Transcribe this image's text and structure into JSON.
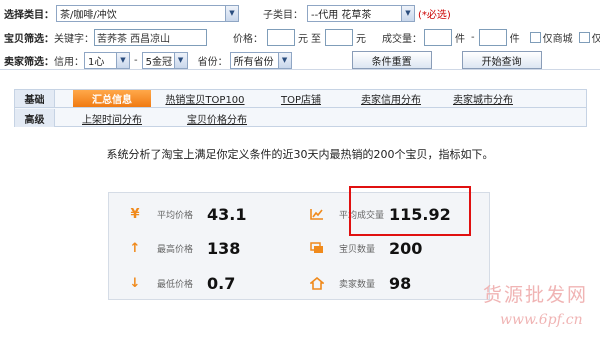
{
  "filters": {
    "category_label": "选择类目：",
    "category_value": "茶/咖啡/冲饮",
    "subcategory_label": "子类目：",
    "subcategory_value": "--代用 花草茶",
    "required_note": "(*必选)",
    "item_filter_label": "宝贝筛选：",
    "keyword_label": "关键字：",
    "keyword_value": "苦荞茶 西昌凉山",
    "price_label": "价格：",
    "price_unit_1": "元",
    "price_to": "至",
    "price_unit_2": "元",
    "sales_label": "成交量：",
    "sales_unit_1": "件",
    "sales_dash": "-",
    "sales_unit_2": "件",
    "mall_only_label": "仅商城",
    "free_ship_label": "仅包邮",
    "seller_filter_label": "卖家筛选：",
    "credit_label": "信用：",
    "credit_min": "1心",
    "credit_dash": "-",
    "credit_max": "5金冠",
    "province_label": "省份：",
    "province_value": "所有省份",
    "reset_button": "条件重置",
    "search_button": "开始查询"
  },
  "tabs": {
    "row1_head": "基础",
    "row1": [
      "汇总信息",
      "热销宝贝TOP100",
      "TOP店铺",
      "卖家信用分布",
      "卖家城市分布"
    ],
    "row2_head": "高级",
    "row2": [
      "上架时间分布",
      "宝贝价格分布"
    ]
  },
  "summary": "系统分析了淘宝上满足你定义条件的近30天内最热销的200个宝贝，指标如下。",
  "stats": {
    "avg_price": {
      "label": "平均价格",
      "value": "43.1",
      "icon": "yen-icon"
    },
    "avg_sales": {
      "label": "平均成交量",
      "value": "115.92",
      "icon": "bar-chart-icon"
    },
    "max_price": {
      "label": "最高价格",
      "value": "138",
      "icon": "arrow-up-icon"
    },
    "item_count": {
      "label": "宝贝数量",
      "value": "200",
      "icon": "gallery-icon"
    },
    "min_price": {
      "label": "最低价格",
      "value": "0.7",
      "icon": "arrow-down-icon"
    },
    "seller_count": {
      "label": "卖家数量",
      "value": "98",
      "icon": "house-icon"
    }
  },
  "colors": {
    "accent": "#f07a12",
    "highlight_box": "#e01010",
    "watermark": "#f0b4b4"
  },
  "watermark": {
    "line1": "货源批发网",
    "line2": "www.6pf.cn"
  }
}
